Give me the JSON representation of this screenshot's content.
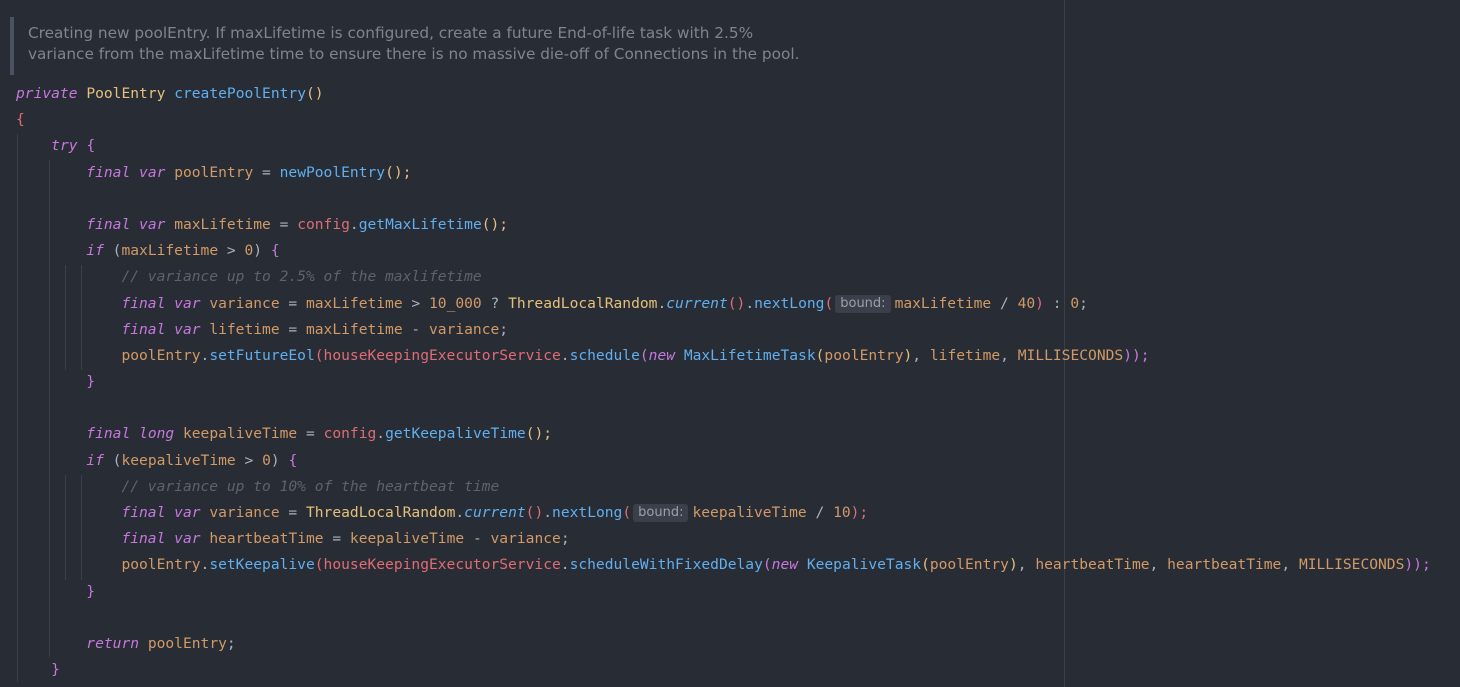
{
  "doc_comment": {
    "line1": "Creating new poolEntry. If maxLifetime is configured, create a future End-of-life task with 2.5%",
    "line2": "variance from the maxLifetime time to ensure there is no massive die-off of Connections in the pool."
  },
  "code": {
    "l1": {
      "private": "private",
      "type": "PoolEntry",
      "name": "createPoolEntry",
      "parens": "()"
    },
    "l2": {
      "brace": "{"
    },
    "l3": {
      "try": "try",
      "brace": "{"
    },
    "l4": {
      "final": "final",
      "var": "var",
      "name": "poolEntry",
      "eq": " = ",
      "call": "newPoolEntry",
      "end": "();"
    },
    "l6": {
      "final": "final",
      "var": "var",
      "name": "maxLifetime",
      "eq": " = ",
      "obj": "config",
      "dot": ".",
      "call": "getMaxLifetime",
      "end": "();"
    },
    "l7": {
      "if": "if",
      "open": "(",
      "name": "maxLifetime",
      "op": " > ",
      "num": "0",
      "close": ")",
      "brace": "{"
    },
    "l8": {
      "comment": "// variance up to 2.5% of the maxlifetime"
    },
    "l9": {
      "final": "final",
      "var": "var",
      "name": "variance",
      "eq": " = ",
      "a": "maxLifetime",
      "gt": " > ",
      "n1": "10_000",
      "q": " ? ",
      "cls": "ThreadLocalRandom",
      "dot": ".",
      "current": "current",
      "p": "()",
      "dot2": ".",
      "call": "nextLong",
      "open": "(",
      "hint": "bound:",
      "arg": "maxLifetime",
      "div": " / ",
      "n2": "40",
      "close": ")",
      "colon": " : ",
      "n3": "0",
      "semi": ";"
    },
    "l10": {
      "final": "final",
      "var": "var",
      "name": "lifetime",
      "eq": " = ",
      "a": "maxLifetime",
      "minus": " - ",
      "b": "variance",
      "semi": ";"
    },
    "l11": {
      "obj": "poolEntry",
      "dot": ".",
      "call": "setFutureEol",
      "open": "(",
      "svc": "houseKeepingExecutorService",
      "dot2": ".",
      "call2": "schedule",
      "open2": "(",
      "new": "new",
      "cls": "MaxLifetimeTask",
      "open3": "(",
      "arg": "poolEntry",
      "close3": ")",
      "comma": ", ",
      "arg2": "lifetime",
      "comma2": ", ",
      "arg3": "MILLISECONDS",
      "close": "));"
    },
    "l12": {
      "brace": "}"
    },
    "l14": {
      "final": "final",
      "long": "long",
      "name": "keepaliveTime",
      "eq": " = ",
      "obj": "config",
      "dot": ".",
      "call": "getKeepaliveTime",
      "end": "();"
    },
    "l15": {
      "if": "if",
      "open": "(",
      "name": "keepaliveTime",
      "op": " > ",
      "num": "0",
      "close": ")",
      "brace": "{"
    },
    "l16": {
      "comment": "// variance up to 10% of the heartbeat time"
    },
    "l17": {
      "final": "final",
      "var": "var",
      "name": "variance",
      "eq": " = ",
      "cls": "ThreadLocalRandom",
      "dot": ".",
      "current": "current",
      "p": "()",
      "dot2": ".",
      "call": "nextLong",
      "open": "(",
      "hint": "bound:",
      "arg": "keepaliveTime",
      "div": " / ",
      "n": "10",
      "close": ");"
    },
    "l18": {
      "final": "final",
      "var": "var",
      "name": "heartbeatTime",
      "eq": " = ",
      "a": "keepaliveTime",
      "minus": " - ",
      "b": "variance",
      "semi": ";"
    },
    "l19": {
      "obj": "poolEntry",
      "dot": ".",
      "call": "setKeepalive",
      "open": "(",
      "svc": "houseKeepingExecutorService",
      "dot2": ".",
      "call2": "scheduleWithFixedDelay",
      "open2": "(",
      "new": "new",
      "cls": "KeepaliveTask",
      "open3": "(",
      "arg": "poolEntry",
      "close3": ")",
      "comma": ", ",
      "arg2": "heartbeatTime",
      "comma2": ", ",
      "arg3": "heartbeatTime",
      "comma3": ", ",
      "arg4": "MILLISECONDS",
      "close": "));"
    },
    "l20": {
      "brace": "}"
    },
    "l22": {
      "return": "return",
      "name": "poolEntry",
      "semi": ";"
    },
    "l23": {
      "brace": "}"
    }
  }
}
